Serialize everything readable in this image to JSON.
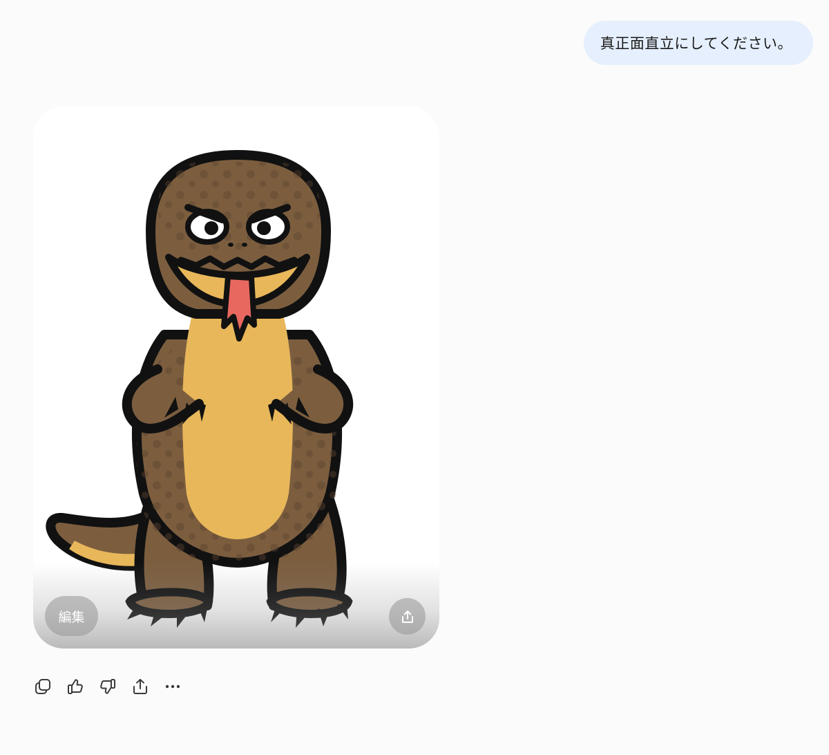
{
  "user_message": {
    "text": "真正面直立にしてください。",
    "bubble_color": "#e5effd"
  },
  "image_card": {
    "subject": "cartoon komodo dragon standing upright, facing front, tongue out",
    "edit_label": "編集",
    "share_icon": "share-upload-icon"
  },
  "action_bar": {
    "icons": [
      "copy-icon",
      "thumbs-up-icon",
      "thumbs-down-icon",
      "share-icon",
      "more-options-icon"
    ]
  },
  "colors": {
    "background": "#fbfbfb",
    "lizard_body": "#7c5e3f",
    "lizard_belly": "#e8b75a",
    "tongue": "#e8685f",
    "outline": "#111111"
  }
}
